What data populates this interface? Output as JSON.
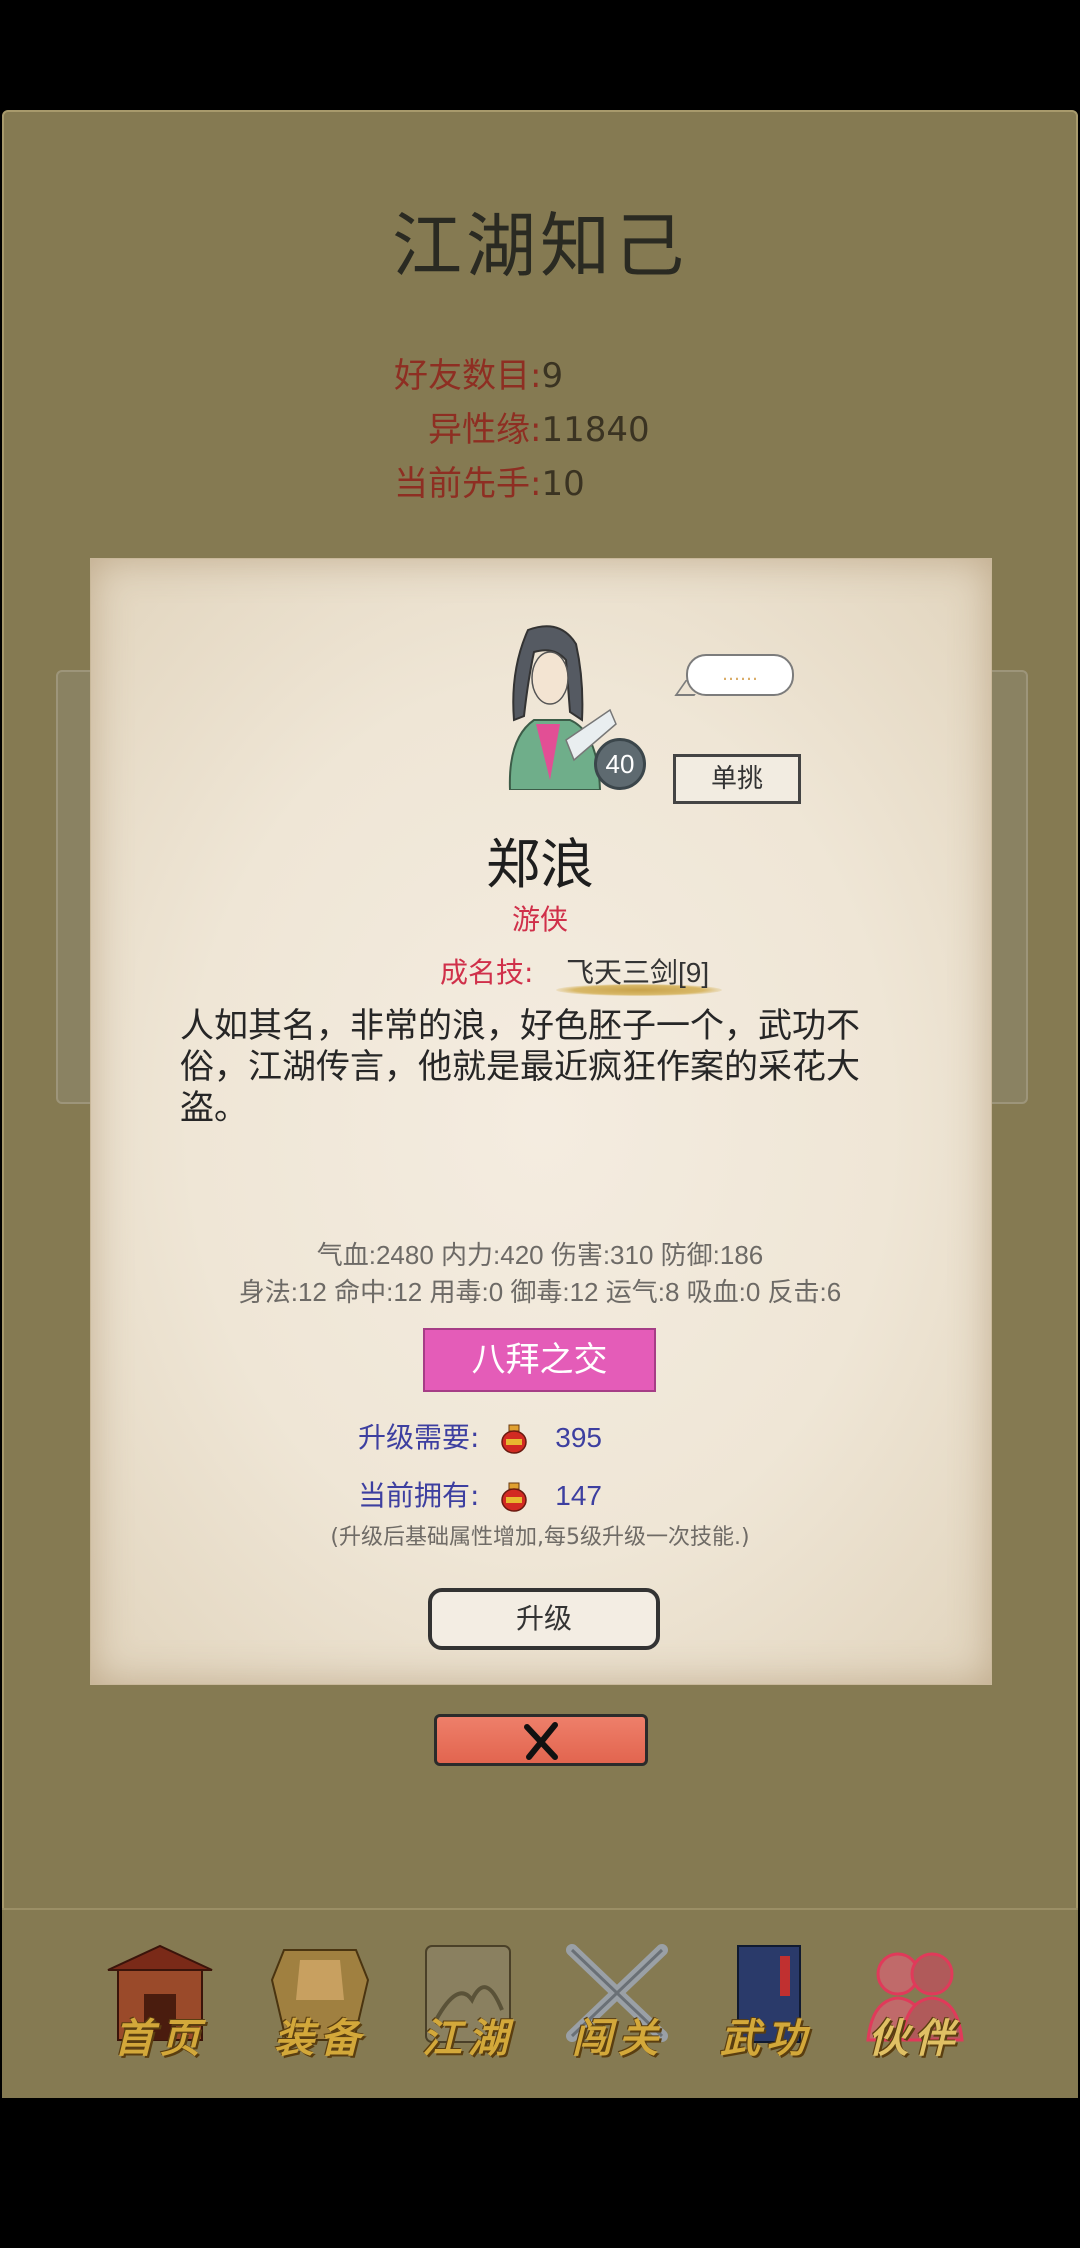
{
  "page": {
    "title": "江湖知己",
    "stats": [
      {
        "label": "好友数目:",
        "value": "9"
      },
      {
        "label": "异性缘:",
        "value": "11840"
      },
      {
        "label": "当前先手:",
        "value": "10"
      }
    ]
  },
  "card": {
    "level": "40",
    "bubble_text": "……",
    "duel_label": "单挑",
    "name": "郑浪",
    "class": "游侠",
    "skill_label": "成名技:",
    "skill_value": "飞天三剑[9]",
    "description": "人如其名，非常的浪，好色胚子一个，武功不俗，江湖传言，他就是最近疯狂作案的采花大盗。",
    "attributes_line1": "气血:2480  内力:420  伤害:310  防御:186",
    "attributes_line2": "身法:12  命中:12  用毒:0  御毒:12  运气:8  吸血:0  反击:6",
    "bond_label": "八拜之交",
    "upgrade_need_label": "升级需要:",
    "upgrade_need_value": "395",
    "current_have_label": "当前拥有:",
    "current_have_value": "147",
    "hint": "(升级后基础属性增加,每5级升级一次技能.)",
    "upgrade_label": "升级"
  },
  "nav": [
    {
      "label": "首页",
      "icon": "gate-icon"
    },
    {
      "label": "装备",
      "icon": "armor-icon"
    },
    {
      "label": "江湖",
      "icon": "scroll-map-icon"
    },
    {
      "label": "闯关",
      "icon": "crossed-swords-icon"
    },
    {
      "label": "武功",
      "icon": "book-icon"
    },
    {
      "label": "伙伴",
      "icon": "partners-icon"
    }
  ],
  "colors": {
    "background": "#857a52",
    "accent_red": "#d0304a",
    "bond_pink": "#e45cb8",
    "close_red": "#e2654f"
  }
}
